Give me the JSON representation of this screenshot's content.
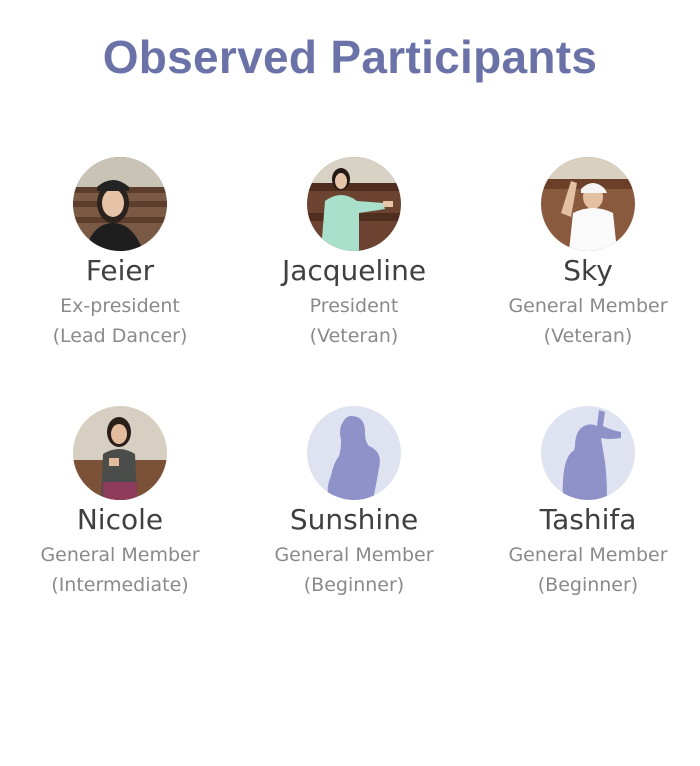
{
  "title": "Observed Participants",
  "participants": [
    {
      "name": "Feier",
      "role": "Ex-president",
      "level": "(Lead Dancer)",
      "avatar": "photo-portrait-icon"
    },
    {
      "name": "Jacqueline",
      "role": "President",
      "level": "(Veteran)",
      "avatar": "photo-dancer-icon"
    },
    {
      "name": "Sky",
      "role": "General Member",
      "level": "(Veteran)",
      "avatar": "photo-cap-dancer-icon"
    },
    {
      "name": "Nicole",
      "role": "General Member",
      "level": "(Intermediate)",
      "avatar": "photo-dancer-icon"
    },
    {
      "name": "Sunshine",
      "role": "General Member",
      "level": "(Beginner)",
      "avatar": "silhouette-icon"
    },
    {
      "name": "Tashifa",
      "role": "General Member",
      "level": "(Beginner)",
      "avatar": "silhouette-pose-icon"
    }
  ],
  "colors": {
    "title": "#6a72a8",
    "silhouette_bg": "#dfe2f1",
    "silhouette_fill": "#8e92c8"
  }
}
